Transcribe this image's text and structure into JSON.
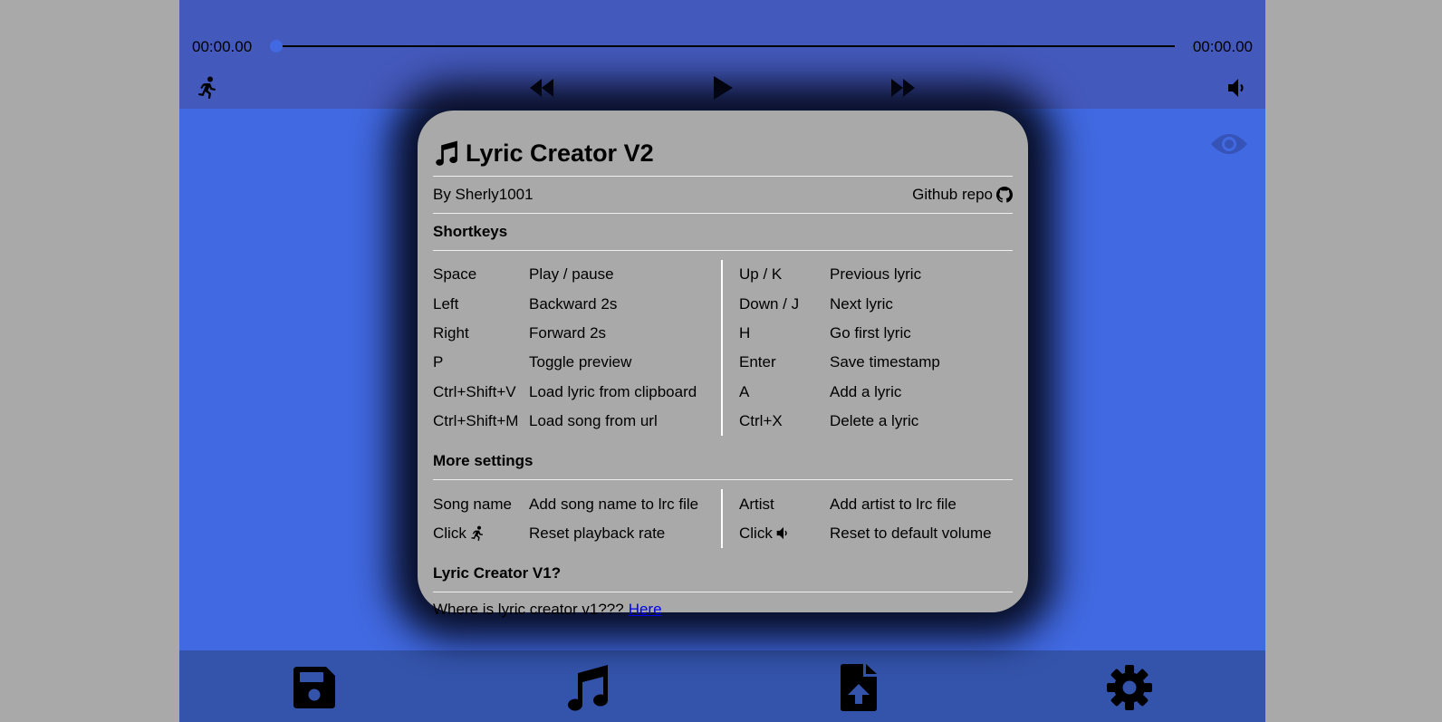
{
  "player": {
    "time_current": "00:00.00",
    "time_total": "00:00.00",
    "progress": 0
  },
  "icons": {
    "playback_rate": "running-person-icon",
    "rewind": "rewind-icon",
    "play": "play-icon",
    "forward": "fast-forward-icon",
    "volume": "volume-icon",
    "preview": "eye-icon",
    "save": "floppy-disk-icon",
    "music": "music-note-icon",
    "upload": "file-upload-icon",
    "settings": "gear-icon",
    "github": "github-icon"
  },
  "colors": {
    "page_bg": "#a9a9a9",
    "app_bg": "#4169e1",
    "topbar_bg": "#4459bc",
    "bottombar_bg": "#3454ac",
    "modal_bg": "#a9a9a9"
  },
  "modal": {
    "title": "Lyric Creator V2",
    "author": "By Sherly1001",
    "repo_link": "Github repo",
    "shortkeys_title": "Shortkeys",
    "shortkeys_left": [
      {
        "key": "Space",
        "action": "Play / pause"
      },
      {
        "key": "Left",
        "action": "Backward 2s"
      },
      {
        "key": "Right",
        "action": "Forward 2s"
      },
      {
        "key": "P",
        "action": "Toggle preview"
      },
      {
        "key": "Ctrl+Shift+V",
        "action": "Load lyric from clipboard"
      },
      {
        "key": "Ctrl+Shift+M",
        "action": "Load song from url"
      }
    ],
    "shortkeys_right": [
      {
        "key": "Up / K",
        "action": "Previous lyric"
      },
      {
        "key": "Down / J",
        "action": "Next lyric"
      },
      {
        "key": "H",
        "action": "Go first lyric"
      },
      {
        "key": "Enter",
        "action": "Save timestamp"
      },
      {
        "key": "A",
        "action": "Add a lyric"
      },
      {
        "key": "Ctrl+X",
        "action": "Delete a lyric"
      }
    ],
    "more_title": "More settings",
    "more_left": [
      {
        "key": "Song name",
        "action": "Add song name to lrc file"
      },
      {
        "key": "Click",
        "action": "Reset playback rate"
      }
    ],
    "more_right": [
      {
        "key": "Artist",
        "action": "Add artist to lrc file"
      },
      {
        "key": "Click",
        "action": "Reset to default volume"
      }
    ],
    "v1_title": "Lyric Creator V1?",
    "v1_text": "Where is lyric creator v1???",
    "v1_link": "Here"
  }
}
